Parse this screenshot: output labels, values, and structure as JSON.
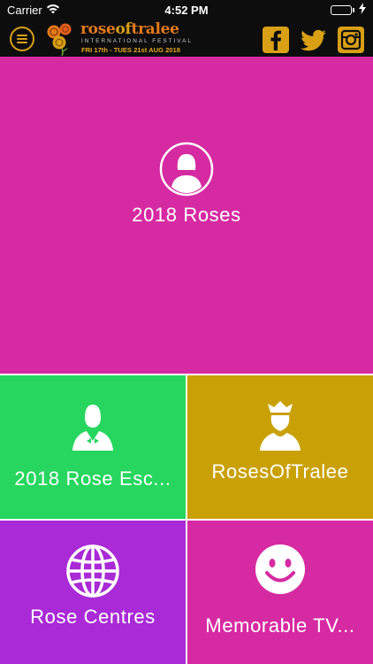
{
  "status_bar": {
    "carrier": "Carrier",
    "time": "4:52 PM",
    "battery_level": 1.0,
    "icons": [
      "wifi-icon",
      "battery-icon",
      "charging-icon"
    ]
  },
  "header": {
    "brand_rose": "rose",
    "brand_of": "of",
    "brand_tralee": "tralee",
    "subtitle": "INTERNATIONAL FESTIVAL",
    "dates": "FRI 17th - TUES 21st AUG 2018",
    "icons": [
      "menu-icon",
      "facebook-icon",
      "twitter-icon",
      "instagram-icon"
    ]
  },
  "tiles": [
    {
      "label": "2018 Roses",
      "icon": "woman-avatar-icon",
      "color": "#d62aa2"
    },
    {
      "label": "2018 Rose Esc...",
      "icon": "man-escort-icon",
      "color": "#26d65e"
    },
    {
      "label": "RosesOfTralee",
      "icon": "crowned-person-icon",
      "color": "#c9a106"
    },
    {
      "label": "Rose Centres",
      "icon": "globe-icon",
      "color": "#a92ad6"
    },
    {
      "label": "Memorable TV...",
      "icon": "smiley-icon",
      "color": "#d62aa2"
    }
  ],
  "colors": {
    "accent_gold": "#d9a016",
    "brand_orange": "#e47a1c",
    "bar_background": "#0d0d0d"
  }
}
